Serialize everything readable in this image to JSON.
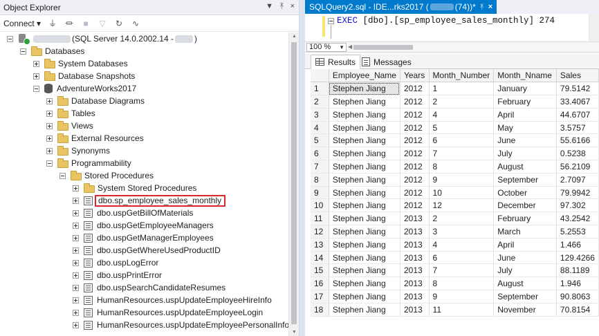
{
  "object_explorer": {
    "title": "Object Explorer",
    "title_controls": [
      "▼",
      "ᛡ",
      "×"
    ],
    "toolbar": {
      "connect_label": "Connect ▾",
      "icons": [
        "connect-icon",
        "disconnect-icon",
        "stop-icon",
        "filter-icon",
        "refresh-icon",
        "activity-icon"
      ]
    },
    "tree": [
      {
        "label": "(SQL Server 14.0.2002.14 -",
        "label_suffix": ")",
        "icon": "server",
        "exp": "minus",
        "level": 0
      },
      {
        "label": "Databases",
        "icon": "folder",
        "exp": "minus",
        "level": 1
      },
      {
        "label": "System Databases",
        "icon": "folder",
        "exp": "plus",
        "level": 2
      },
      {
        "label": "Database Snapshots",
        "icon": "folder",
        "exp": "plus",
        "level": 2
      },
      {
        "label": "AdventureWorks2017",
        "icon": "db",
        "exp": "minus",
        "level": 2
      },
      {
        "label": "Database Diagrams",
        "icon": "folder",
        "exp": "plus",
        "level": 3
      },
      {
        "label": "Tables",
        "icon": "folder",
        "exp": "plus",
        "level": 3
      },
      {
        "label": "Views",
        "icon": "folder",
        "exp": "plus",
        "level": 3
      },
      {
        "label": "External Resources",
        "icon": "folder",
        "exp": "plus",
        "level": 3
      },
      {
        "label": "Synonyms",
        "icon": "folder",
        "exp": "plus",
        "level": 3
      },
      {
        "label": "Programmability",
        "icon": "folder",
        "exp": "minus",
        "level": 3
      },
      {
        "label": "Stored Procedures",
        "icon": "folder",
        "exp": "minus",
        "level": 4
      },
      {
        "label": "System Stored Procedures",
        "icon": "folder",
        "exp": "plus",
        "level": 5
      },
      {
        "label": "dbo.sp_employee_sales_monthly",
        "icon": "sp",
        "exp": "plus",
        "level": 5,
        "highlight": true
      },
      {
        "label": "dbo.uspGetBillOfMaterials",
        "icon": "sp",
        "exp": "plus",
        "level": 5
      },
      {
        "label": "dbo.uspGetEmployeeManagers",
        "icon": "sp",
        "exp": "plus",
        "level": 5
      },
      {
        "label": "dbo.uspGetManagerEmployees",
        "icon": "sp",
        "exp": "plus",
        "level": 5
      },
      {
        "label": "dbo.uspGetWhereUsedProductID",
        "icon": "sp",
        "exp": "plus",
        "level": 5
      },
      {
        "label": "dbo.uspLogError",
        "icon": "sp",
        "exp": "plus",
        "level": 5
      },
      {
        "label": "dbo.uspPrintError",
        "icon": "sp",
        "exp": "plus",
        "level": 5
      },
      {
        "label": "dbo.uspSearchCandidateResumes",
        "icon": "sp",
        "exp": "plus",
        "level": 5
      },
      {
        "label": "HumanResources.uspUpdateEmployeeHireInfo",
        "icon": "sp",
        "exp": "plus",
        "level": 5
      },
      {
        "label": "HumanResources.uspUpdateEmployeeLogin",
        "icon": "sp",
        "exp": "plus",
        "level": 5
      },
      {
        "label": "HumanResources.uspUpdateEmployeePersonalInfo",
        "icon": "sp",
        "exp": "plus",
        "level": 5
      }
    ]
  },
  "query_tab": {
    "label_prefix": "SQLQuery2.sql - IDE...rks2017 (",
    "label_suffix": "(74))*",
    "pin": "ᛡ",
    "close": "×"
  },
  "editor": {
    "keyword": "EXEC",
    "code": " [dbo].[sp_employee_sales_monthly] 274"
  },
  "zoom": {
    "value": "100 %"
  },
  "result_tabs": [
    {
      "label": "Results",
      "icon": "grid-icon",
      "active": true
    },
    {
      "label": "Messages",
      "icon": "messages-icon",
      "active": false
    }
  ],
  "results": {
    "columns": [
      "",
      "Employee_Name",
      "Years",
      "Month_Number",
      "Month_Nname",
      "Sales"
    ],
    "rows": [
      [
        "1",
        "Stephen Jiang",
        "2012",
        "1",
        "January",
        "79.5142"
      ],
      [
        "2",
        "Stephen Jiang",
        "2012",
        "2",
        "February",
        "33.4067"
      ],
      [
        "3",
        "Stephen Jiang",
        "2012",
        "4",
        "April",
        "44.6707"
      ],
      [
        "4",
        "Stephen Jiang",
        "2012",
        "5",
        "May",
        "3.5757"
      ],
      [
        "5",
        "Stephen Jiang",
        "2012",
        "6",
        "June",
        "55.6166"
      ],
      [
        "6",
        "Stephen Jiang",
        "2012",
        "7",
        "July",
        "0.5238"
      ],
      [
        "7",
        "Stephen Jiang",
        "2012",
        "8",
        "August",
        "56.2109"
      ],
      [
        "8",
        "Stephen Jiang",
        "2012",
        "9",
        "September",
        "2.7097"
      ],
      [
        "9",
        "Stephen Jiang",
        "2012",
        "10",
        "October",
        "79.9942"
      ],
      [
        "10",
        "Stephen Jiang",
        "2012",
        "12",
        "December",
        "97.302"
      ],
      [
        "11",
        "Stephen Jiang",
        "2013",
        "2",
        "February",
        "43.2542"
      ],
      [
        "12",
        "Stephen Jiang",
        "2013",
        "3",
        "March",
        "5.2553"
      ],
      [
        "13",
        "Stephen Jiang",
        "2013",
        "4",
        "April",
        "1.466"
      ],
      [
        "14",
        "Stephen Jiang",
        "2013",
        "6",
        "June",
        "129.4266"
      ],
      [
        "15",
        "Stephen Jiang",
        "2013",
        "7",
        "July",
        "88.1189"
      ],
      [
        "16",
        "Stephen Jiang",
        "2013",
        "8",
        "August",
        "1.946"
      ],
      [
        "17",
        "Stephen Jiang",
        "2013",
        "9",
        "September",
        "90.8063"
      ],
      [
        "18",
        "Stephen Jiang",
        "2013",
        "11",
        "November",
        "70.8154"
      ]
    ]
  }
}
